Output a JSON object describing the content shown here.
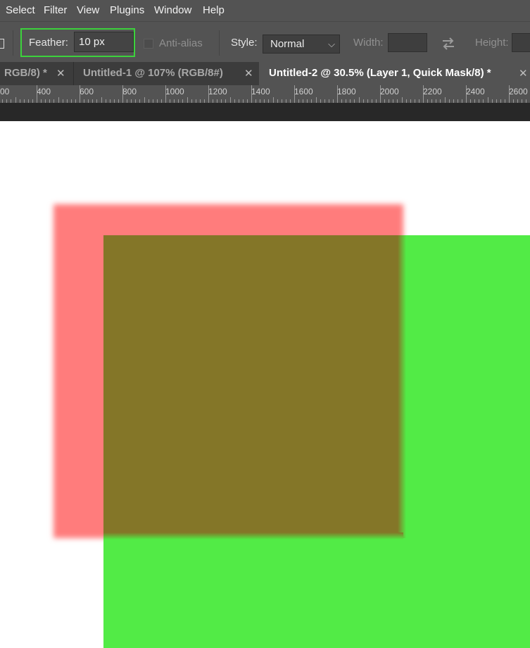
{
  "menu": [
    "Select",
    "Filter",
    "View",
    "Plugins",
    "Window",
    "Help"
  ],
  "options": {
    "feather_label": "Feather:",
    "feather_value": "10 px",
    "antialias_label": "Anti-alias",
    "style_label": "Style:",
    "style_value": "Normal",
    "width_label": "Width:",
    "height_label": "Height:"
  },
  "tabs": [
    {
      "label": "RGB/8) *",
      "active": false
    },
    {
      "label": "Untitled-1 @ 107% (RGB/8#)",
      "active": false
    },
    {
      "label": "Untitled-2 @ 30.5% (Layer 1, Quick Mask/8) *",
      "active": true
    }
  ],
  "ruler": [
    "00",
    "400",
    "600",
    "800",
    "1000",
    "1200",
    "1400",
    "1600",
    "1800",
    "2000",
    "2200",
    "2400",
    "2600"
  ],
  "colors": {
    "highlight": "#3cd23c",
    "quick_mask_red": "#ff7c7c",
    "layer_green": "#52eb46",
    "overlap": "#847628"
  },
  "icons": {
    "close": "close-icon",
    "dropdown": "chevron-down-icon",
    "swap": "swap-arrows-icon"
  }
}
